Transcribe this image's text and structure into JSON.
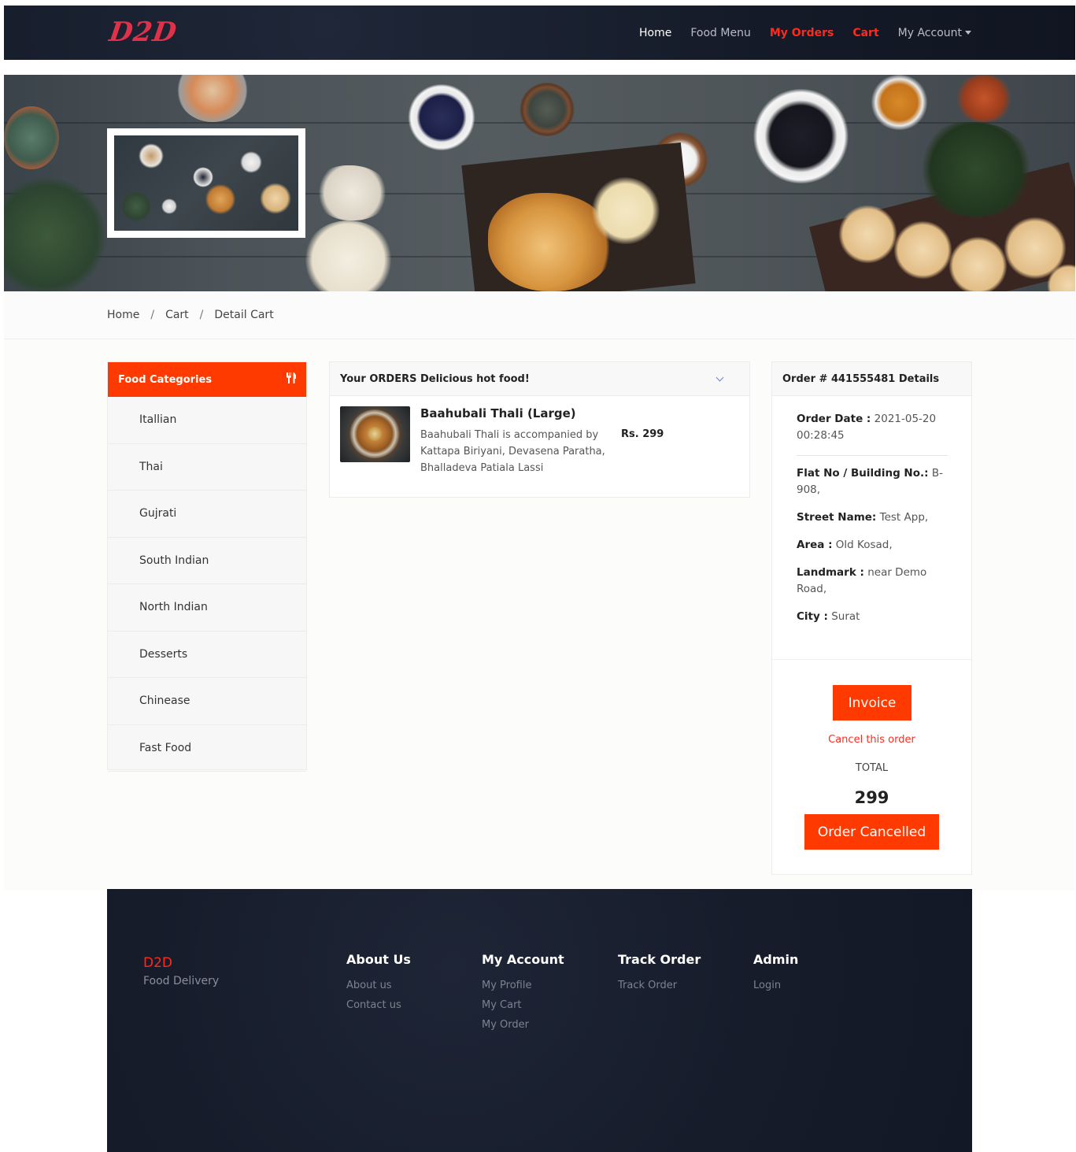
{
  "nav": {
    "logo": "D2D",
    "links": [
      {
        "label": "Home"
      },
      {
        "label": "Food Menu"
      },
      {
        "label": "My Orders"
      },
      {
        "label": "Cart"
      },
      {
        "label": "My Account"
      }
    ]
  },
  "breadcrumb": [
    "Home",
    "Cart",
    "Detail Cart"
  ],
  "sidebar": {
    "title": "Food Categories",
    "items": [
      "Itallian",
      "Thai",
      "Gujrati",
      "South Indian",
      "North Indian",
      "Desserts",
      "Chinease",
      "Fast Food"
    ]
  },
  "orders": {
    "title": "Your ORDERS Delicious hot food!",
    "item": {
      "name": "Baahubali Thali (Large)",
      "description": "Baahubali Thali is accompanied by Kattapa Biriyani, Devasena Paratha, Bhalladeva Patiala Lassi",
      "price": "Rs. 299"
    }
  },
  "details": {
    "title": "Order # 441555481 Details",
    "order_date_label": "Order Date :",
    "order_date": "2021-05-20 00:28:45",
    "flat_label": "Flat No / Building No.:",
    "flat": "B-908,",
    "street_label": "Street Name:",
    "street": "Test App,",
    "area_label": "Area :",
    "area": "Old Kosad,",
    "landmark_label": "Landmark :",
    "landmark": "near Demo Road,",
    "city_label": "City :",
    "city": "Surat",
    "invoice_label": "Invoice",
    "cancel_label": "Cancel this order",
    "total_label": "TOTAL",
    "total": "299",
    "status_label": "Order Cancelled"
  },
  "footer": {
    "brand": "D2D",
    "tagline": "Food Delivery",
    "about": {
      "title": "About Us",
      "links": [
        "About us",
        "Contact us"
      ]
    },
    "account": {
      "title": "My Account",
      "links": [
        "My Profile",
        "My Cart",
        "My Order"
      ]
    },
    "track": {
      "title": "Track Order",
      "links": [
        "Track Order"
      ]
    },
    "admin": {
      "title": "Admin",
      "links": [
        "Login"
      ]
    }
  },
  "colors": {
    "accent": "#ff3a00",
    "nav_bg": "#141a27",
    "link_red": "#ff2a1e"
  }
}
